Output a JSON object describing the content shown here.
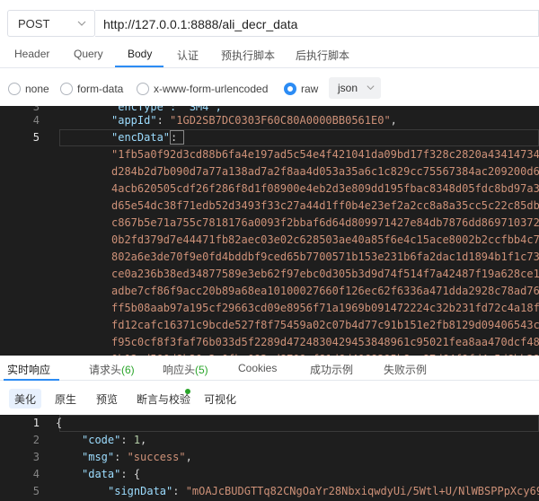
{
  "request": {
    "method": "POST",
    "url": "http://127.0.0.1:8888/ali_decr_data"
  },
  "request_tabs": [
    "Header",
    "Query",
    "Body",
    "认证",
    "预执行脚本",
    "后执行脚本"
  ],
  "body_types": {
    "options": [
      "none",
      "form-data",
      "x-www-form-urlencoded",
      "raw"
    ],
    "selected": "raw",
    "format": "json"
  },
  "request_editor": {
    "line3": {
      "num": "3",
      "text": "\"encType\": \"SM4\","
    },
    "line4": {
      "num": "4",
      "key": "\"appId\"",
      "value": "\"1GD2SB7DC0303F60C80A0000BB0561E0\""
    },
    "line5": {
      "num": "5",
      "key": "\"encData\""
    },
    "enc_lines": [
      "\"1fb5a0f92d3cd88b6fa4e197ad5c54e4f421041da09bd17f328c2820a43414734c",
      "d284b2d7b090d7a77a138ad7a2f8aa4d053a35a6c1c829cc75567384ac209200d62",
      "4acb620505cdf26f286f8d1f08900e4eb2d3e809dd195fbac8348d05fdc8bd97a35",
      "d65e54dc38f71edb52d3493f33c27a44d1ff0b4e23ef2a2cc8a8a35cc5c22c85dbf",
      "c867b5e71a755c7818176a0093f2bbaf6d64d809971427e84db7876dd8697103720",
      "0b2fd379d7e44471fb82aec03e02c628503ae40a85f6e4c15ace8002b2ccfbb4c7c",
      "802a6e3de70f9e0fd4bddbf9ced65b7700571b153e231b6fa2dac1d1894b1f1c73b",
      "ce0a236b38ed34877589e3eb62f97ebc0d305b3d9d74f514f7a42487f19a628ce12",
      "adbe7cf86f9acc20b89a68ea10100027660f126ec62f6336a471dda2928c78ad76f",
      "ff5b08aab97a195cf29663cd09e8956f71a1969b091472224c32b231fd72c4a18f",
      "fd12cafc16371c9bcde527f8f75459a02c07b4d77c91b151e2fb8129d09406543c6",
      "f95c0cf8f3faf76b033d5f2289d4724830429453848961c95021fea8aa470dcf486",
      "0b12cd590d8b20a3e0fbc093ed8709af81d6d4068295b8ea87d64f9fd4e5d6bb396"
    ]
  },
  "response_tabs": {
    "realtime": "实时响应",
    "req_headers": "请求头",
    "req_headers_count": "(6)",
    "resp_headers": "响应头",
    "resp_headers_count": "(5)",
    "cookies": "Cookies",
    "success_example": "成功示例",
    "fail_example": "失败示例"
  },
  "response_subtabs": [
    "美化",
    "原生",
    "预览",
    "断言与校验",
    "可视化"
  ],
  "response_editor": {
    "lines": [
      {
        "num": "1",
        "text": "{"
      },
      {
        "num": "2",
        "key": "\"code\"",
        "value": "1"
      },
      {
        "num": "3",
        "key": "\"msg\"",
        "value": "\"success\""
      },
      {
        "num": "4",
        "key": "\"data\"",
        "open": "{"
      },
      {
        "num": "5",
        "key": "\"signData\"",
        "value": "\"mOAJcBUDGTTq82CNgOaYr28NbxiqwdyUi/5Wtl+U/NlWBSPPpXcy69S"
      }
    ]
  },
  "colors": {
    "accent": "#2c8cf4",
    "editor_bg": "#1e1e1e",
    "json_key": "#9cdcfe",
    "json_string": "#ce9178",
    "json_number": "#b5cea8",
    "count_green": "#2aa52a"
  }
}
